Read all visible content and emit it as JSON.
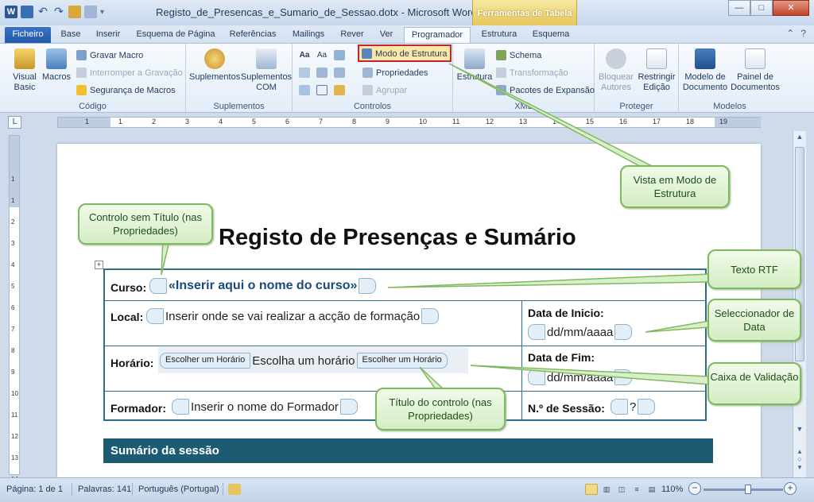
{
  "window": {
    "title": "Registo_de_Presencas_e_Sumario_de_Sessao.dotx - Microsoft Word",
    "context_tab_header": "Ferramentas de Tabela",
    "minimize": "—",
    "maximize": "□",
    "close": "✕"
  },
  "qat": {
    "app_icon": "W",
    "undo": "↶",
    "redo": "↷",
    "more": "▾"
  },
  "tabs": {
    "file": "Ficheiro",
    "home": "Base",
    "insert": "Inserir",
    "page_layout": "Esquema de Página",
    "references": "Referências",
    "mailings": "Mailings",
    "review": "Rever",
    "view": "Ver",
    "developer": "Programador",
    "design": "Estrutura",
    "layout": "Esquema"
  },
  "ribbon": {
    "codigo": {
      "label": "Código",
      "visual_basic_1": "Visual",
      "visual_basic_2": "Basic",
      "macros": "Macros",
      "record_macro": "Gravar Macro",
      "pause_recording": "Interromper a Gravação",
      "macro_security": "Segurança de Macros"
    },
    "suplementos": {
      "label": "Suplementos",
      "addins": "Suplementos",
      "com_addins_1": "Suplementos",
      "com_addins_2": "COM"
    },
    "controlos": {
      "label": "Controlos",
      "aa1": "Aa",
      "aa2": "Aa",
      "design_mode": "Modo de Estrutura",
      "properties": "Propriedades",
      "group": "Agrupar"
    },
    "xml": {
      "label": "XML",
      "structure": "Estrutura",
      "schema": "Schema",
      "transformation": "Transformação",
      "expansion_packs": "Pacotes de Expansão"
    },
    "proteger": {
      "label": "Proteger",
      "block_authors_1": "Bloquear",
      "block_authors_2": "Autores",
      "restrict_editing_1": "Restringir",
      "restrict_editing_2": "Edição"
    },
    "modelos": {
      "label": "Modelos",
      "doc_template_1": "Modelo de",
      "doc_template_2": "Documento",
      "doc_panel_1": "Painel de",
      "doc_panel_2": "Documentos"
    },
    "ruler_tab": "L"
  },
  "ruler": {
    "h_numbers": [
      "1",
      "1",
      "2",
      "3",
      "4",
      "5",
      "6",
      "7",
      "8",
      "9",
      "10",
      "11",
      "12",
      "13",
      "14",
      "15",
      "16",
      "17",
      "18",
      "19"
    ],
    "v_numbers": [
      "1",
      "1",
      "2",
      "3",
      "4",
      "5",
      "6",
      "7",
      "8",
      "9",
      "10",
      "11",
      "12",
      "13",
      "14"
    ]
  },
  "document": {
    "title": "Registo de Presenças e Sumário",
    "anchor": "+",
    "curso_label": "Curso:",
    "curso_value": "«Inserir aqui o nome do curso»",
    "local_label": "Local:",
    "local_value": "Inserir onde se vai realizar a acção de formação",
    "data_inicio_label": "Data de Inicio:",
    "data_inicio_value": "dd/mm/aaaa",
    "horario_label": "Horário:",
    "horario_tag": "Escolher um Horário",
    "horario_value": "Escolha um horário",
    "data_fim_label": "Data de Fim:",
    "data_fim_value": "dd/mm/aaaa",
    "formador_label": "Formador:",
    "formador_value": "Inserir o nome do Formador",
    "sessao_label": "N.º de Sessão:",
    "sessao_value": "?",
    "summary_header": "Sumário da sessão"
  },
  "callouts": {
    "vista": "Vista em Modo de Estrutura",
    "sem_titulo": "Controlo sem Título (nas Propriedades)",
    "rtf": "Texto RTF",
    "data": "Seleccionador de Data",
    "validacao": "Caixa de Validação",
    "titulo_controlo": "Título do controlo (nas Propriedades)"
  },
  "status": {
    "page": "Página: 1 de 1",
    "words": "Palavras: 141",
    "language": "Português (Portugal)",
    "zoom": "110%",
    "zoom_out": "−",
    "zoom_in": "+"
  },
  "colors": {
    "accent": "#2b5797",
    "table_border": "#2e6d8a",
    "summary_header": "#1b5c73",
    "callout_border": "#7fb861",
    "highlight_box": "#c0262d"
  }
}
